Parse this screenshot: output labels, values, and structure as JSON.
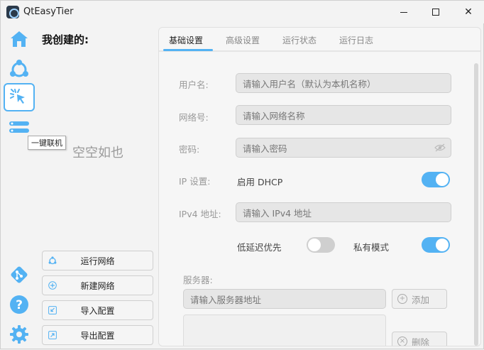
{
  "window": {
    "title": "QtEasyTier"
  },
  "iconbar": {
    "items": [
      {
        "icon": "home-icon"
      },
      {
        "icon": "network-nodes-icon"
      },
      {
        "icon": "click-cursor-icon",
        "active": true
      },
      {
        "icon": "server-list-icon"
      }
    ],
    "bottom": [
      {
        "icon": "git-icon"
      },
      {
        "icon": "help-icon"
      },
      {
        "icon": "gear-icon"
      }
    ],
    "tooltip": "一键联机"
  },
  "mid": {
    "title": "我创建的:",
    "empty": "空空如也",
    "buttons": [
      {
        "label": "运行网络",
        "icon": "run-network-icon"
      },
      {
        "label": "新建网络",
        "icon": "plus-icon"
      },
      {
        "label": "导入配置",
        "icon": "import-icon"
      },
      {
        "label": "导出配置",
        "icon": "export-icon"
      }
    ]
  },
  "tabs": [
    "基础设置",
    "高级设置",
    "运行状态",
    "运行日志"
  ],
  "form": {
    "username_label": "用户名:",
    "username_placeholder": "请输入用户名（默认为本机名称）",
    "netname_label": "网络号:",
    "netname_placeholder": "请输入网络名称",
    "password_label": "密码:",
    "password_placeholder": "请输入密码",
    "ip_label": "IP 设置:",
    "dhcp_label": "启用 DHCP",
    "dhcp_on": true,
    "ipv4_label": "IPv4 地址:",
    "ipv4_placeholder": "请输入 IPv4 地址",
    "low_latency_label": "低延迟优先",
    "low_latency_on": false,
    "private_label": "私有模式",
    "private_on": true,
    "server_label": "服务器:",
    "server_placeholder": "请输入服务器地址",
    "add_label": "添加",
    "delete_label": "删除"
  },
  "colors": {
    "accent": "#53b2f3",
    "icon": "#53b2f3"
  }
}
